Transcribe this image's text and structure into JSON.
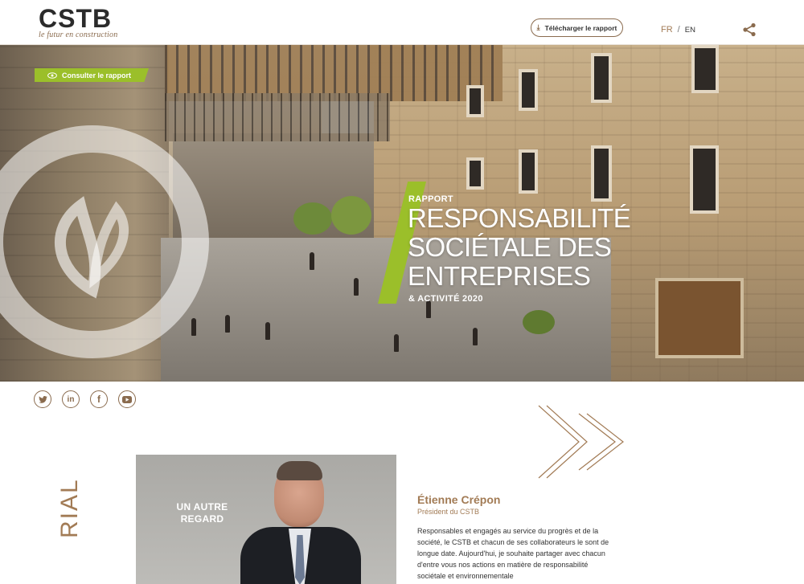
{
  "header": {
    "logo_main": "CSTB",
    "logo_tagline": "le futur en construction",
    "download_label": "Télécharger le rapport",
    "lang_fr": "FR",
    "lang_sep": "/",
    "lang_en": "EN",
    "share_icon": "share-icon"
  },
  "hero": {
    "consult_label": "Consulter le rapport",
    "kicker": "RAPPORT",
    "title_lines": [
      "RESPONSABILITÉ",
      "SOCIÉTALE DES",
      "ENTREPRISES"
    ],
    "subtitle": "& ACTIVITÉ 2020",
    "accent_color": "#9bbf2a"
  },
  "social": [
    {
      "name": "twitter",
      "glyph": "t"
    },
    {
      "name": "linkedin",
      "glyph": "in"
    },
    {
      "name": "facebook",
      "glyph": "f"
    },
    {
      "name": "youtube",
      "glyph": "▶"
    }
  ],
  "editorial": {
    "portrait_label": "UN AUTRE REGARD",
    "vertical_label": "RIAL",
    "name": "Étienne Crépon",
    "role": "Président du CSTB",
    "intro": "Responsables et engagés au service du progrès et de la société, le CSTB et chacun de ses collaborateurs le sont de longue date. Aujourd'hui, je souhaite partager avec chacun d'entre vous nos actions en matière de responsabilité sociétale et environnementale"
  },
  "colors": {
    "brand_brown": "#8a6b4e",
    "accent_green": "#9bbf2a"
  }
}
